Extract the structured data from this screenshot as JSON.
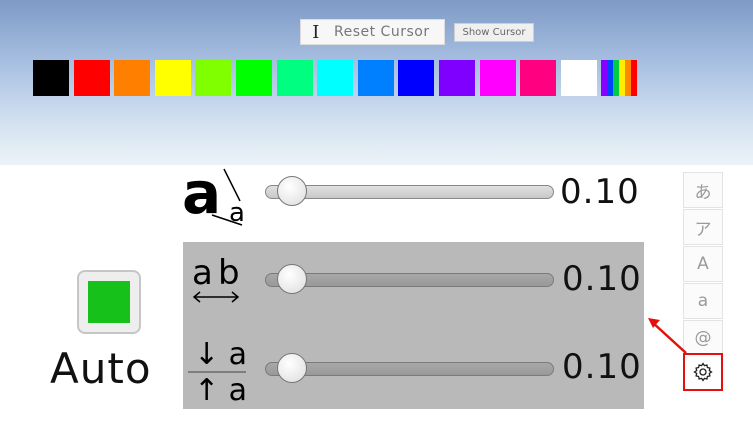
{
  "toolbar": {
    "reset_label": "Reset Cursor",
    "show_label": "Show Cursor",
    "cursor_glyph": "I"
  },
  "palette": {
    "colors": [
      "#000000",
      "#ff0000",
      "#ff8000",
      "#ffff00",
      "#80ff00",
      "#00ff00",
      "#00ff80",
      "#00ffff",
      "#0080ff",
      "#0000ff",
      "#8000ff",
      "#ff00ff",
      "#ff0080",
      "#ffffff"
    ],
    "rainbow": [
      "#8800ff",
      "#0044ff",
      "#00cc44",
      "#ffee00",
      "#ff8800",
      "#ff0000"
    ]
  },
  "size_slider": {
    "value_text": "0.10",
    "value": 0.1,
    "glyph_big": "a",
    "glyph_small": "a"
  },
  "auto": {
    "label": "Auto",
    "color": "#16c21a"
  },
  "spacing_slider": {
    "value_text": "0.10",
    "value": 0.1,
    "glyph_a": "a",
    "glyph_b": "b"
  },
  "line_slider": {
    "value_text": "0.10",
    "value": 0.1,
    "glyph_down": "↓ a",
    "glyph_up": "↑ a"
  },
  "side_tabs": [
    "あ",
    "ア",
    "A",
    "a",
    "@"
  ],
  "settings": {
    "icon": "gear-icon",
    "highlight_color": "#e3110e"
  }
}
